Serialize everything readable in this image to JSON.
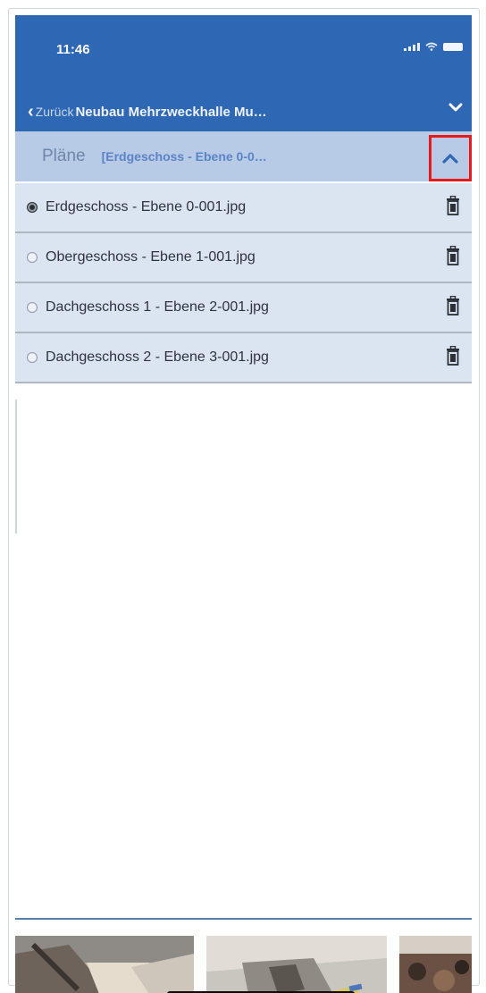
{
  "status_bar": {
    "time": "11:46"
  },
  "nav": {
    "back_label": "Zurück",
    "title": "Neubau Mehrzweckhalle Mu…",
    "menu_icon": "chevron-down-icon"
  },
  "plans": {
    "label": "Pläne",
    "current": "[Erdgeschoss - Ebene 0-0…",
    "collapse_icon": "chevron-up-icon",
    "items": [
      {
        "label": "Erdgeschoss - Ebene 0-001.jpg",
        "selected": true
      },
      {
        "label": "Obergeschoss - Ebene 1-001.jpg",
        "selected": false
      },
      {
        "label": "Dachgeschoss 1 - Ebene 2-001.jpg",
        "selected": false
      },
      {
        "label": "Dachgeschoss 2 - Ebene 3-001.jpg",
        "selected": false
      }
    ]
  },
  "colors": {
    "nav_bar": "#2e67b3",
    "plans_header": "#b8cbe6",
    "list_row": "#dbe4f1",
    "highlight": "#e51a1a"
  },
  "thumbnails": [
    "photo-thumbnail",
    "photo-thumbnail",
    "photo-thumbnail"
  ]
}
